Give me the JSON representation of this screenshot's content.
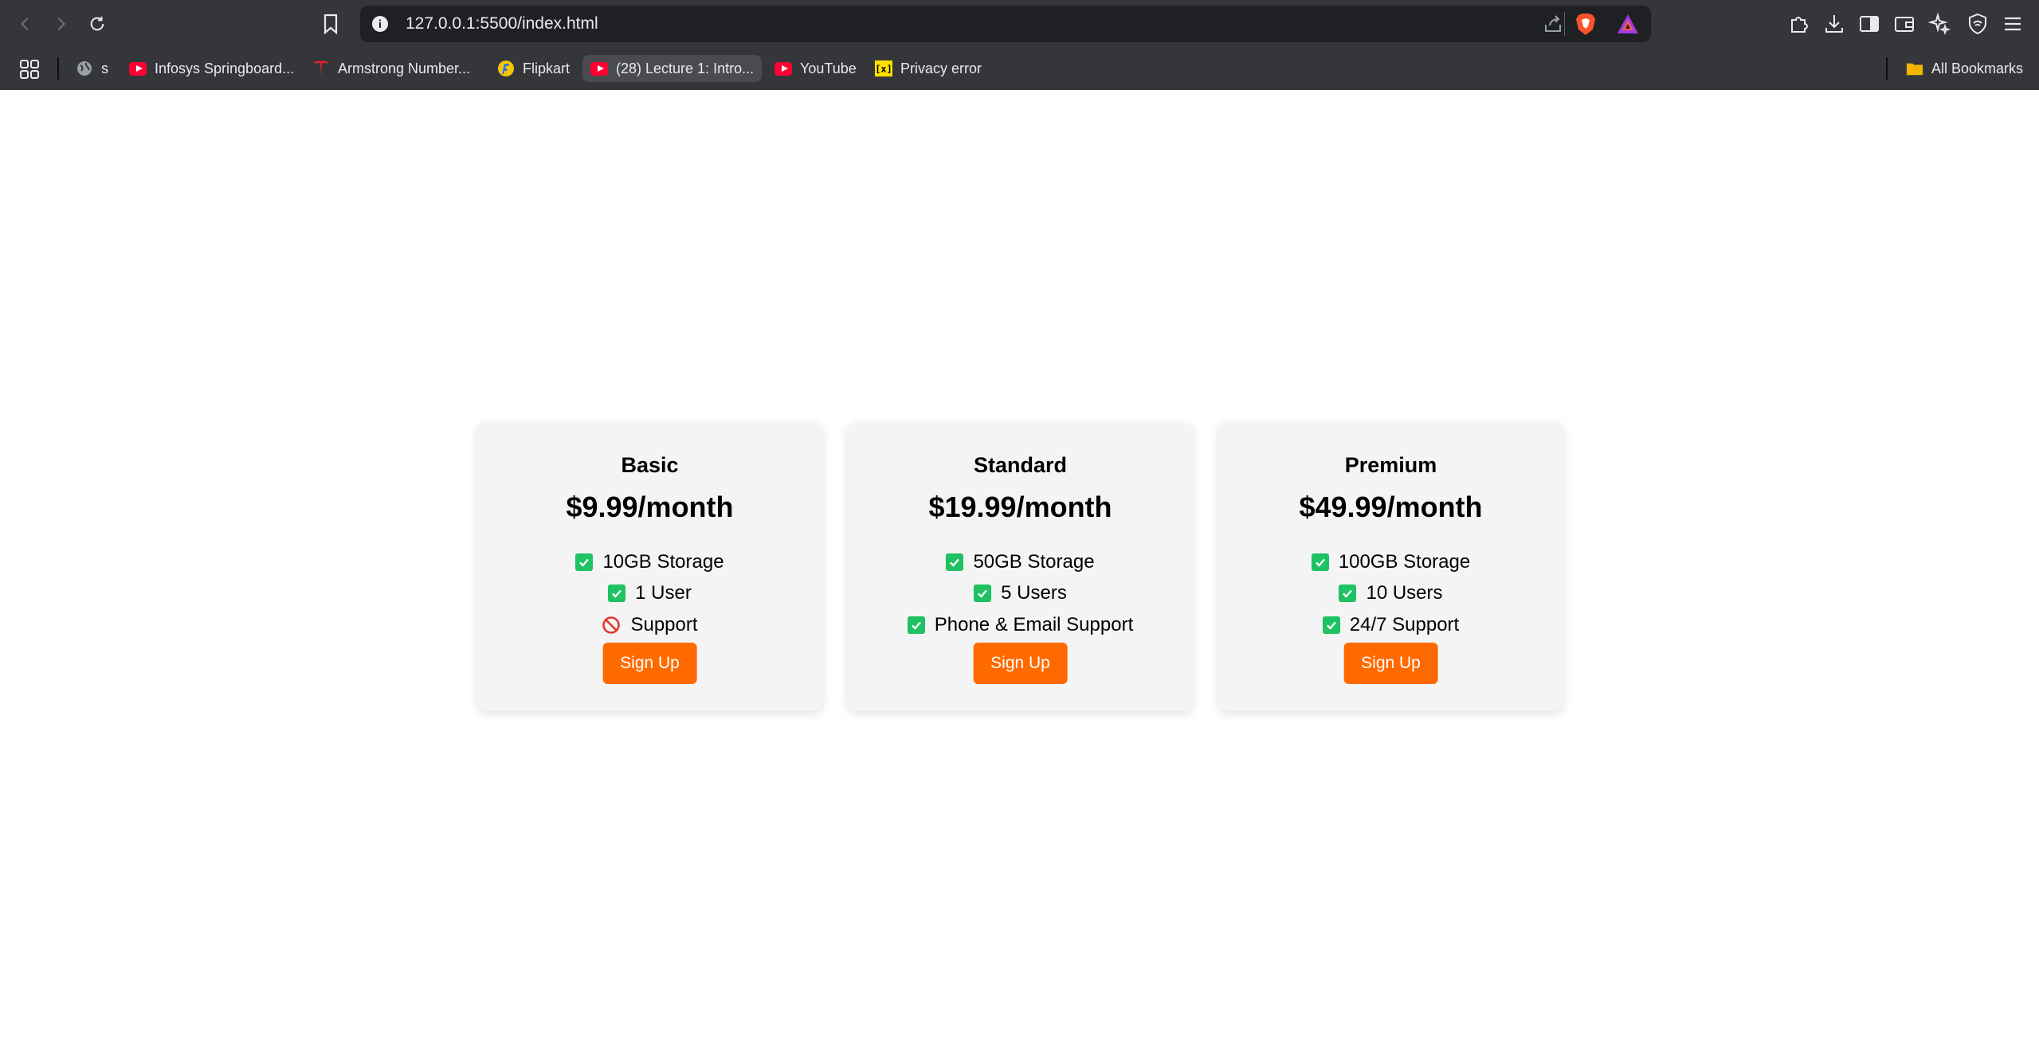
{
  "browser": {
    "url": "127.0.0.1:5500/index.html",
    "bookmarks": [
      {
        "label": "s",
        "icon": "globe-icon"
      },
      {
        "label": "Infosys Springboard...",
        "icon": "youtube-icon"
      },
      {
        "label": "Armstrong Number...",
        "icon": "tesla-icon"
      },
      {
        "label": "Flipkart",
        "icon": "flipkart-icon"
      },
      {
        "label": "(28) Lecture 1: Intro...",
        "icon": "youtube-icon"
      },
      {
        "label": "YouTube",
        "icon": "youtube-icon"
      },
      {
        "label": "Privacy error",
        "icon": "warning-icon"
      }
    ],
    "all_bookmarks": "All Bookmarks"
  },
  "plans": [
    {
      "name": "Basic",
      "price": "$9.99/month",
      "features": [
        {
          "text": "10GB Storage",
          "included": true
        },
        {
          "text": "1 User",
          "included": true
        },
        {
          "text": "Support",
          "included": false
        }
      ],
      "button": "Sign Up"
    },
    {
      "name": "Standard",
      "price": "$19.99/month",
      "features": [
        {
          "text": "50GB Storage",
          "included": true
        },
        {
          "text": "5 Users",
          "included": true
        },
        {
          "text": "Phone & Email Support",
          "included": true
        }
      ],
      "button": "Sign Up"
    },
    {
      "name": "Premium",
      "price": "$49.99/month",
      "features": [
        {
          "text": "100GB Storage",
          "included": true
        },
        {
          "text": "10 Users",
          "included": true
        },
        {
          "text": "24/7 Support",
          "included": true
        }
      ],
      "button": "Sign Up"
    }
  ],
  "colors": {
    "accent": "#ff6a00",
    "check": "#1ec262",
    "excluded": "#e53935",
    "card_bg": "#f4f4f4"
  }
}
